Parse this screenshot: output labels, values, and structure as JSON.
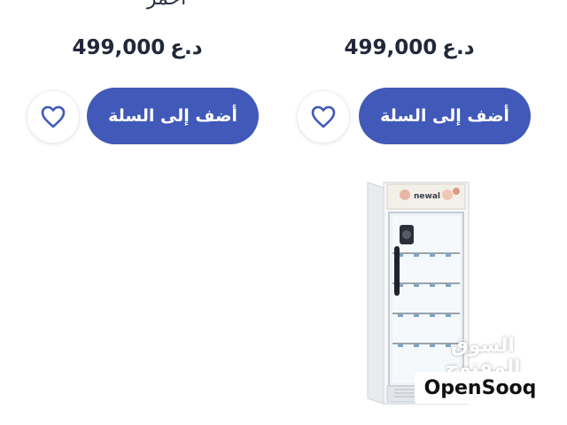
{
  "products": [
    {
      "title_fragment": "أحمر",
      "price_value": "499,000",
      "price_currency": "د.ع",
      "add_to_cart_label": "أضف إلى السلة",
      "wishlist_icon": "heart-outline-icon"
    },
    {
      "price_value": "499,000",
      "price_currency": "د.ع",
      "add_to_cart_label": "أضف إلى السلة",
      "wishlist_icon": "heart-outline-icon"
    }
  ],
  "product_image": {
    "brand_text": "newal"
  },
  "watermark": {
    "arabic": "السوق المفتوح",
    "english": "OpenSooq"
  },
  "colors": {
    "primary_button": "#4159b8",
    "heart_outline": "#4159b8",
    "price_text": "#22283a"
  }
}
